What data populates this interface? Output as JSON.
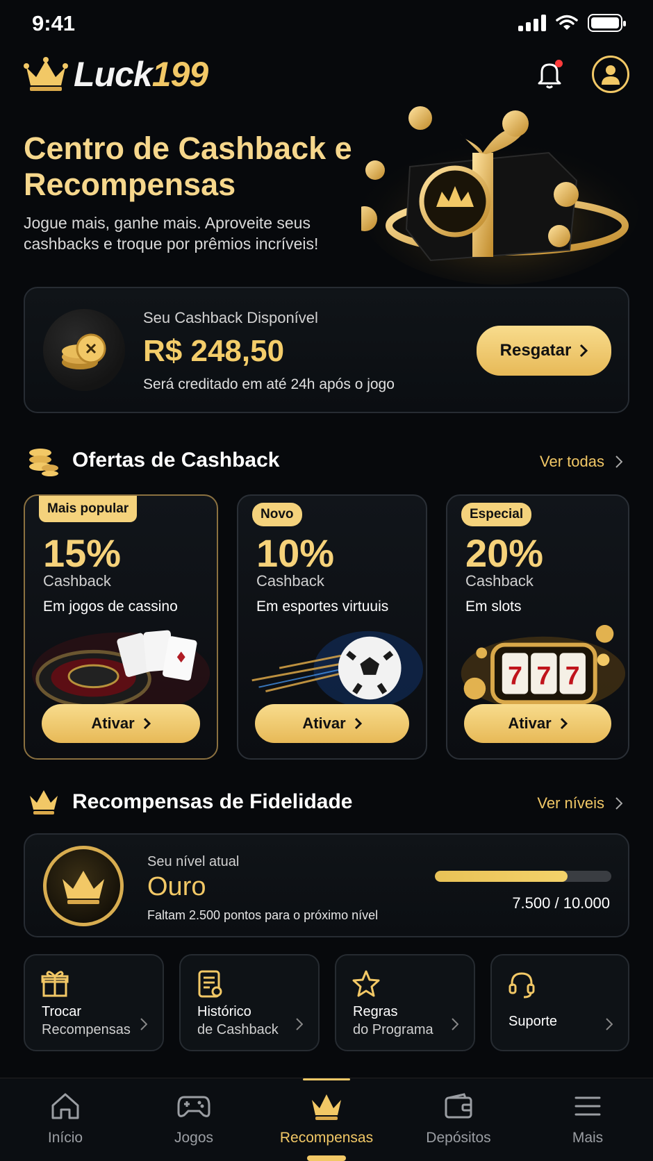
{
  "status": {
    "time": "9:41"
  },
  "brand": {
    "name_part1": "Luck",
    "name_part2": "199"
  },
  "hero": {
    "title": "Centro de Cashback e Recompensas",
    "subtitle": "Jogue mais, ganhe mais. Aproveite seus cashbacks e troque por prêmios incríveis!"
  },
  "cashback": {
    "label": "Seu Cashback Disponível",
    "amount": "R$ 248,50",
    "note": "Será creditado em até 24h após o jogo",
    "button": "Resgatar"
  },
  "offers_section": {
    "title": "Ofertas de Cashback",
    "more": "Ver todas"
  },
  "offers": [
    {
      "badge": "Mais popular",
      "percent": "15%",
      "label": "Cashback",
      "desc": "Em jogos de cassino",
      "button": "Ativar",
      "art": "roulette-cards"
    },
    {
      "badge": "Novo",
      "percent": "10%",
      "label": "Cashback",
      "desc": "Em esportes virtuuis",
      "button": "Ativar",
      "art": "soccer-ball"
    },
    {
      "badge": "Especial",
      "percent": "20%",
      "label": "Cashback",
      "desc": "Em slots",
      "button": "Ativar",
      "art": "slot-machine-777"
    }
  ],
  "loyalty_section": {
    "title": "Recompensas de Fidelidade",
    "more": "Ver níveis"
  },
  "loyalty": {
    "label": "Seu nível atual",
    "level": "Ouro",
    "note": "Faltam 2.500 pontos para o próximo nível",
    "progress_text": "7.500 / 10.000",
    "progress_fraction": 0.75
  },
  "tiles": [
    {
      "line1": "Trocar",
      "line2": "Recompensas",
      "icon": "gift-icon"
    },
    {
      "line1": "Histórico",
      "line2": "de Cashback",
      "icon": "receipt-icon"
    },
    {
      "line1": "Regras",
      "line2": "do Programa",
      "icon": "star-icon"
    },
    {
      "line1": "Suporte",
      "line2": "",
      "icon": "headset-icon"
    }
  ],
  "nav": [
    {
      "label": "Início",
      "icon": "home-icon"
    },
    {
      "label": "Jogos",
      "icon": "gamepad-icon"
    },
    {
      "label": "Recompensas",
      "icon": "crown-icon",
      "active": true
    },
    {
      "label": "Depósitos",
      "icon": "wallet-icon"
    },
    {
      "label": "Mais",
      "icon": "menu-icon"
    }
  ],
  "colors": {
    "accent": "#f2c866",
    "background": "#07090c",
    "card": "#101418"
  }
}
